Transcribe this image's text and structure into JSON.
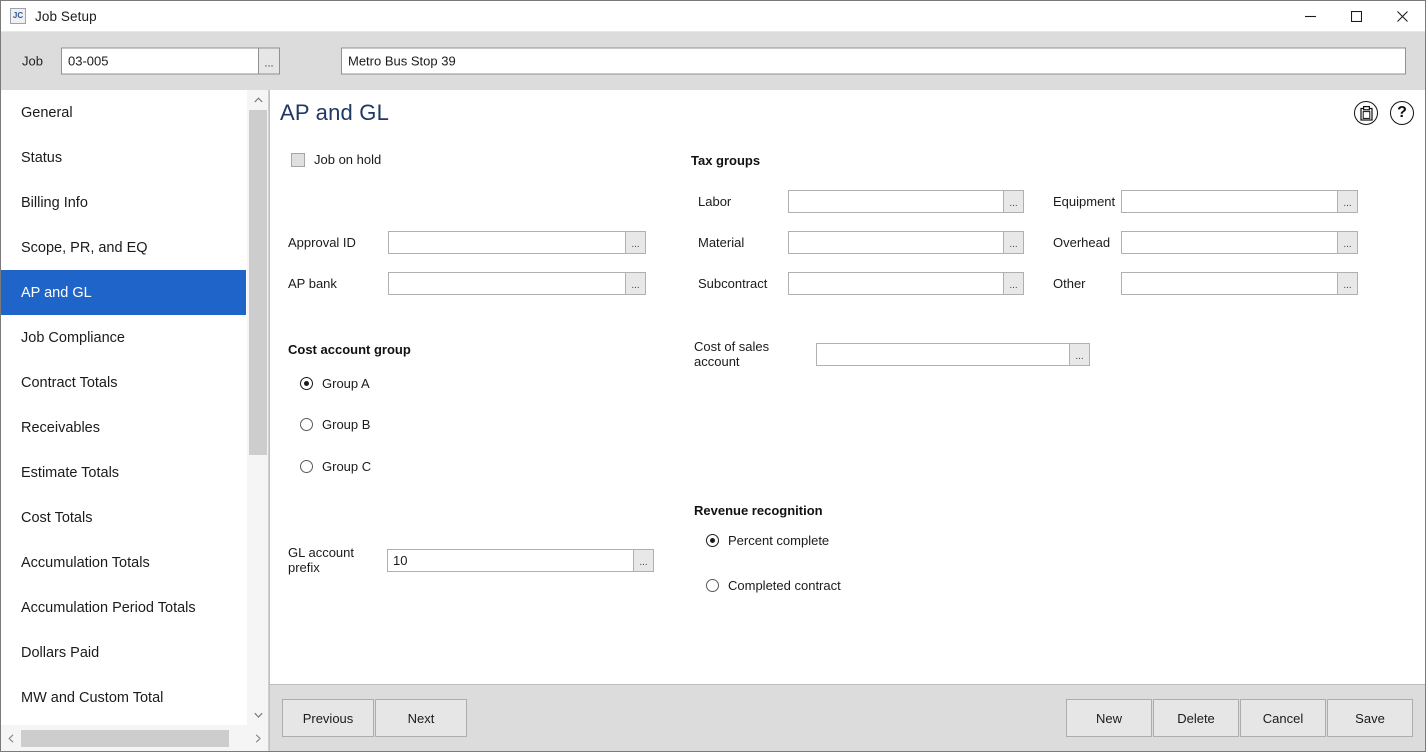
{
  "window": {
    "title": "Job Setup",
    "app_icon": "JC",
    "controls": {
      "minimize": "minimize-icon",
      "maximize": "maximize-icon",
      "close": "close-icon"
    }
  },
  "jobbar": {
    "job_label": "Job",
    "job_number": "03-005",
    "job_number_placeholder": "",
    "browse_label": "...",
    "job_name": "Metro Bus Stop 39",
    "job_name_placeholder": ""
  },
  "sidebar": {
    "items": [
      {
        "label": "General",
        "active": false
      },
      {
        "label": "Status",
        "active": false
      },
      {
        "label": "Billing Info",
        "active": false
      },
      {
        "label": "Scope, PR, and EQ",
        "active": false
      },
      {
        "label": "AP and GL",
        "active": true
      },
      {
        "label": "Job Compliance",
        "active": false
      },
      {
        "label": "Contract Totals",
        "active": false
      },
      {
        "label": "Receivables",
        "active": false
      },
      {
        "label": "Estimate Totals",
        "active": false
      },
      {
        "label": "Cost Totals",
        "active": false
      },
      {
        "label": "Accumulation Totals",
        "active": false
      },
      {
        "label": "Accumulation Period Totals",
        "active": false
      },
      {
        "label": "Dollars Paid",
        "active": false
      },
      {
        "label": "MW and Custom Total",
        "active": false
      }
    ],
    "scroll_up": "chevron-up-icon",
    "scroll_down": "chevron-down-icon",
    "scroll_left": "chevron-left-icon",
    "scroll_right": "chevron-right-icon"
  },
  "content": {
    "title": "AP and GL",
    "paste_icon": "clipboard-icon",
    "help_icon": "help-icon",
    "job_on_hold": {
      "label": "Job on hold",
      "checked": false
    },
    "approval_id": {
      "label": "Approval ID",
      "value": "",
      "placeholder": "",
      "browse_label": "..."
    },
    "ap_bank": {
      "label": "AP bank",
      "value": "",
      "placeholder": "",
      "browse_label": "..."
    },
    "cost_account_group": {
      "heading": "Cost account group",
      "options": [
        {
          "label": "Group A",
          "selected": true
        },
        {
          "label": "Group B",
          "selected": false
        },
        {
          "label": "Group C",
          "selected": false
        }
      ]
    },
    "gl_account_prefix": {
      "label": "GL account prefix",
      "value": "10",
      "placeholder": "",
      "browse_label": "..."
    },
    "tax_groups": {
      "heading": "Tax groups",
      "fields": [
        {
          "label": "Labor",
          "value": "",
          "browse_label": "..."
        },
        {
          "label": "Material",
          "value": "",
          "browse_label": "..."
        },
        {
          "label": "Subcontract",
          "value": "",
          "browse_label": "..."
        },
        {
          "label": "Equipment",
          "value": "",
          "browse_label": "..."
        },
        {
          "label": "Overhead",
          "value": "",
          "browse_label": "..."
        },
        {
          "label": "Other",
          "value": "",
          "browse_label": "..."
        }
      ]
    },
    "cost_of_sales_account": {
      "label": "Cost of sales account",
      "value": "",
      "placeholder": "",
      "browse_label": "..."
    },
    "revenue_recognition": {
      "heading": "Revenue recognition",
      "options": [
        {
          "label": "Percent complete",
          "selected": true
        },
        {
          "label": "Completed contract",
          "selected": false
        }
      ]
    }
  },
  "footer": {
    "previous": "Previous",
    "next": "Next",
    "new": "New",
    "delete": "Delete",
    "cancel": "Cancel",
    "save": "Save"
  },
  "colors": {
    "accent": "#1f64c8",
    "title_text": "#1f3864",
    "chrome": "#dcdcdc"
  }
}
